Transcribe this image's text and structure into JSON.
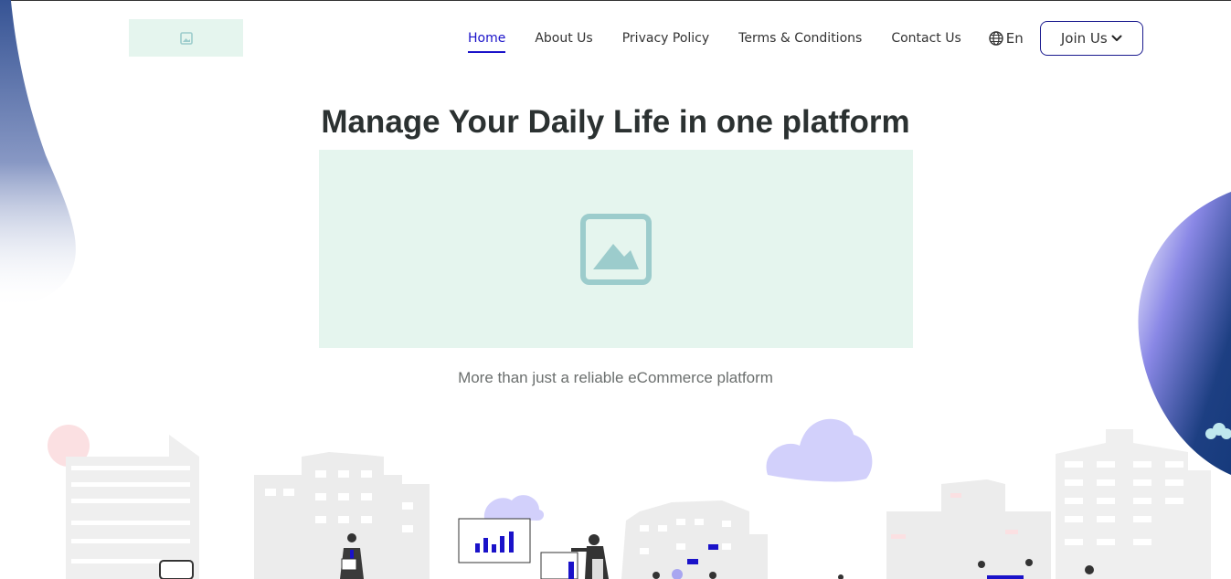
{
  "header": {
    "logo_icon": "image-placeholder-icon",
    "nav": [
      {
        "label": "Home",
        "active": true
      },
      {
        "label": "About Us",
        "active": false
      },
      {
        "label": "Privacy Policy",
        "active": false
      },
      {
        "label": "Terms & Conditions",
        "active": false
      },
      {
        "label": "Contact Us",
        "active": false
      }
    ],
    "language": {
      "icon": "globe-icon",
      "label": "En"
    },
    "join": {
      "label": "Join Us",
      "icon": "chevron-down-icon"
    }
  },
  "hero": {
    "title": "Manage Your Daily Life in one platform",
    "image_icon": "image-placeholder-icon",
    "subtitle": "More than just a reliable eCommerce platform"
  },
  "colors": {
    "accent": "#1a12c9",
    "placeholder_bg": "#e5f5ee",
    "placeholder_icon": "#9ccccc",
    "blob_blue": "#1a3f82",
    "cloud": "#d2d0fb"
  }
}
